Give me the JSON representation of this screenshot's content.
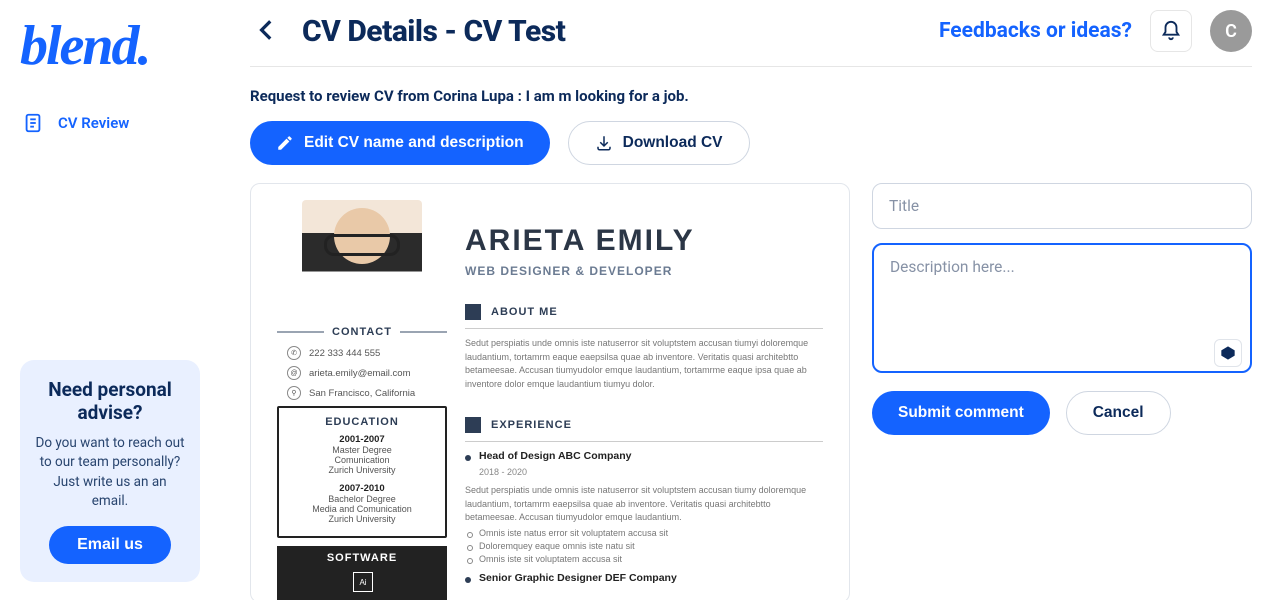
{
  "brand": "blend.",
  "sidebar": {
    "nav": [
      {
        "label": "CV Review"
      }
    ]
  },
  "help_card": {
    "title": "Need personal advise?",
    "body": "Do you want to reach out to our team personally? Just write us an an email.",
    "cta": "Email us"
  },
  "header": {
    "title": "CV Details - CV Test",
    "feedback_label": "Feedbacks or ideas?",
    "avatar_initial": "C"
  },
  "request_line": "Request to review CV from Corina Lupa : I am m looking for a job.",
  "actions": {
    "edit_label": "Edit CV name and description",
    "download_label": "Download CV"
  },
  "cv": {
    "name": "ARIETA EMILY",
    "role": "WEB DESIGNER & DEVELOPER",
    "contact_heading": "CONTACT",
    "contacts": {
      "phone": "222 333 444 555",
      "email": "arieta.emily@email.com",
      "location": "San Francisco, California"
    },
    "education_heading": "EDUCATION",
    "education": [
      {
        "period": "2001-2007",
        "degree": "Master Degree",
        "field": "Comunication",
        "school": "Zurich University"
      },
      {
        "period": "2007-2010",
        "degree": "Bachelor Degree",
        "field": "Media and Comunication",
        "school": "Zurich University"
      }
    ],
    "software_heading": "SOFTWARE",
    "software_icons": [
      "Ai"
    ],
    "about_heading": "ABOUT ME",
    "about_body": "Sedut perspiatis unde omnis iste natuserror sit voluptstem accusan tiumyi doloremque laudantium, tortamrm eaque eaepsilsa quae ab inventore. Veritatis quasi architebtto betameesae. Accusan tiumyudolor emque laudantium, tortamrme eaque ipsa quae ab inventore dolor emque laudantium tiumyu dolor.",
    "experience_heading": "EXPERIENCE",
    "experience": [
      {
        "title": "Head of Design ABC Company",
        "dates": "2018 - 2020",
        "summary": "Sedut perspiatis unde omnis iste natuserror sit voluptstem accusan tiumy doloremque laudantium, tortamrm eaepsilsa quae ab inventore. Veritatis quasi architebtto betameesae. Accusan tiumyudolor emque laudantium.",
        "bullets": [
          "Omnis iste natus error sit voluptatem accusa sit",
          "Doloremquey eaque omnis iste natu sit",
          "Omnis iste sit voluptatem accusa sit"
        ]
      },
      {
        "title": "Senior Graphic Designer DEF Company"
      }
    ]
  },
  "comment": {
    "title_placeholder": "Title",
    "desc_placeholder": "Description here...",
    "submit_label": "Submit comment",
    "cancel_label": "Cancel"
  }
}
